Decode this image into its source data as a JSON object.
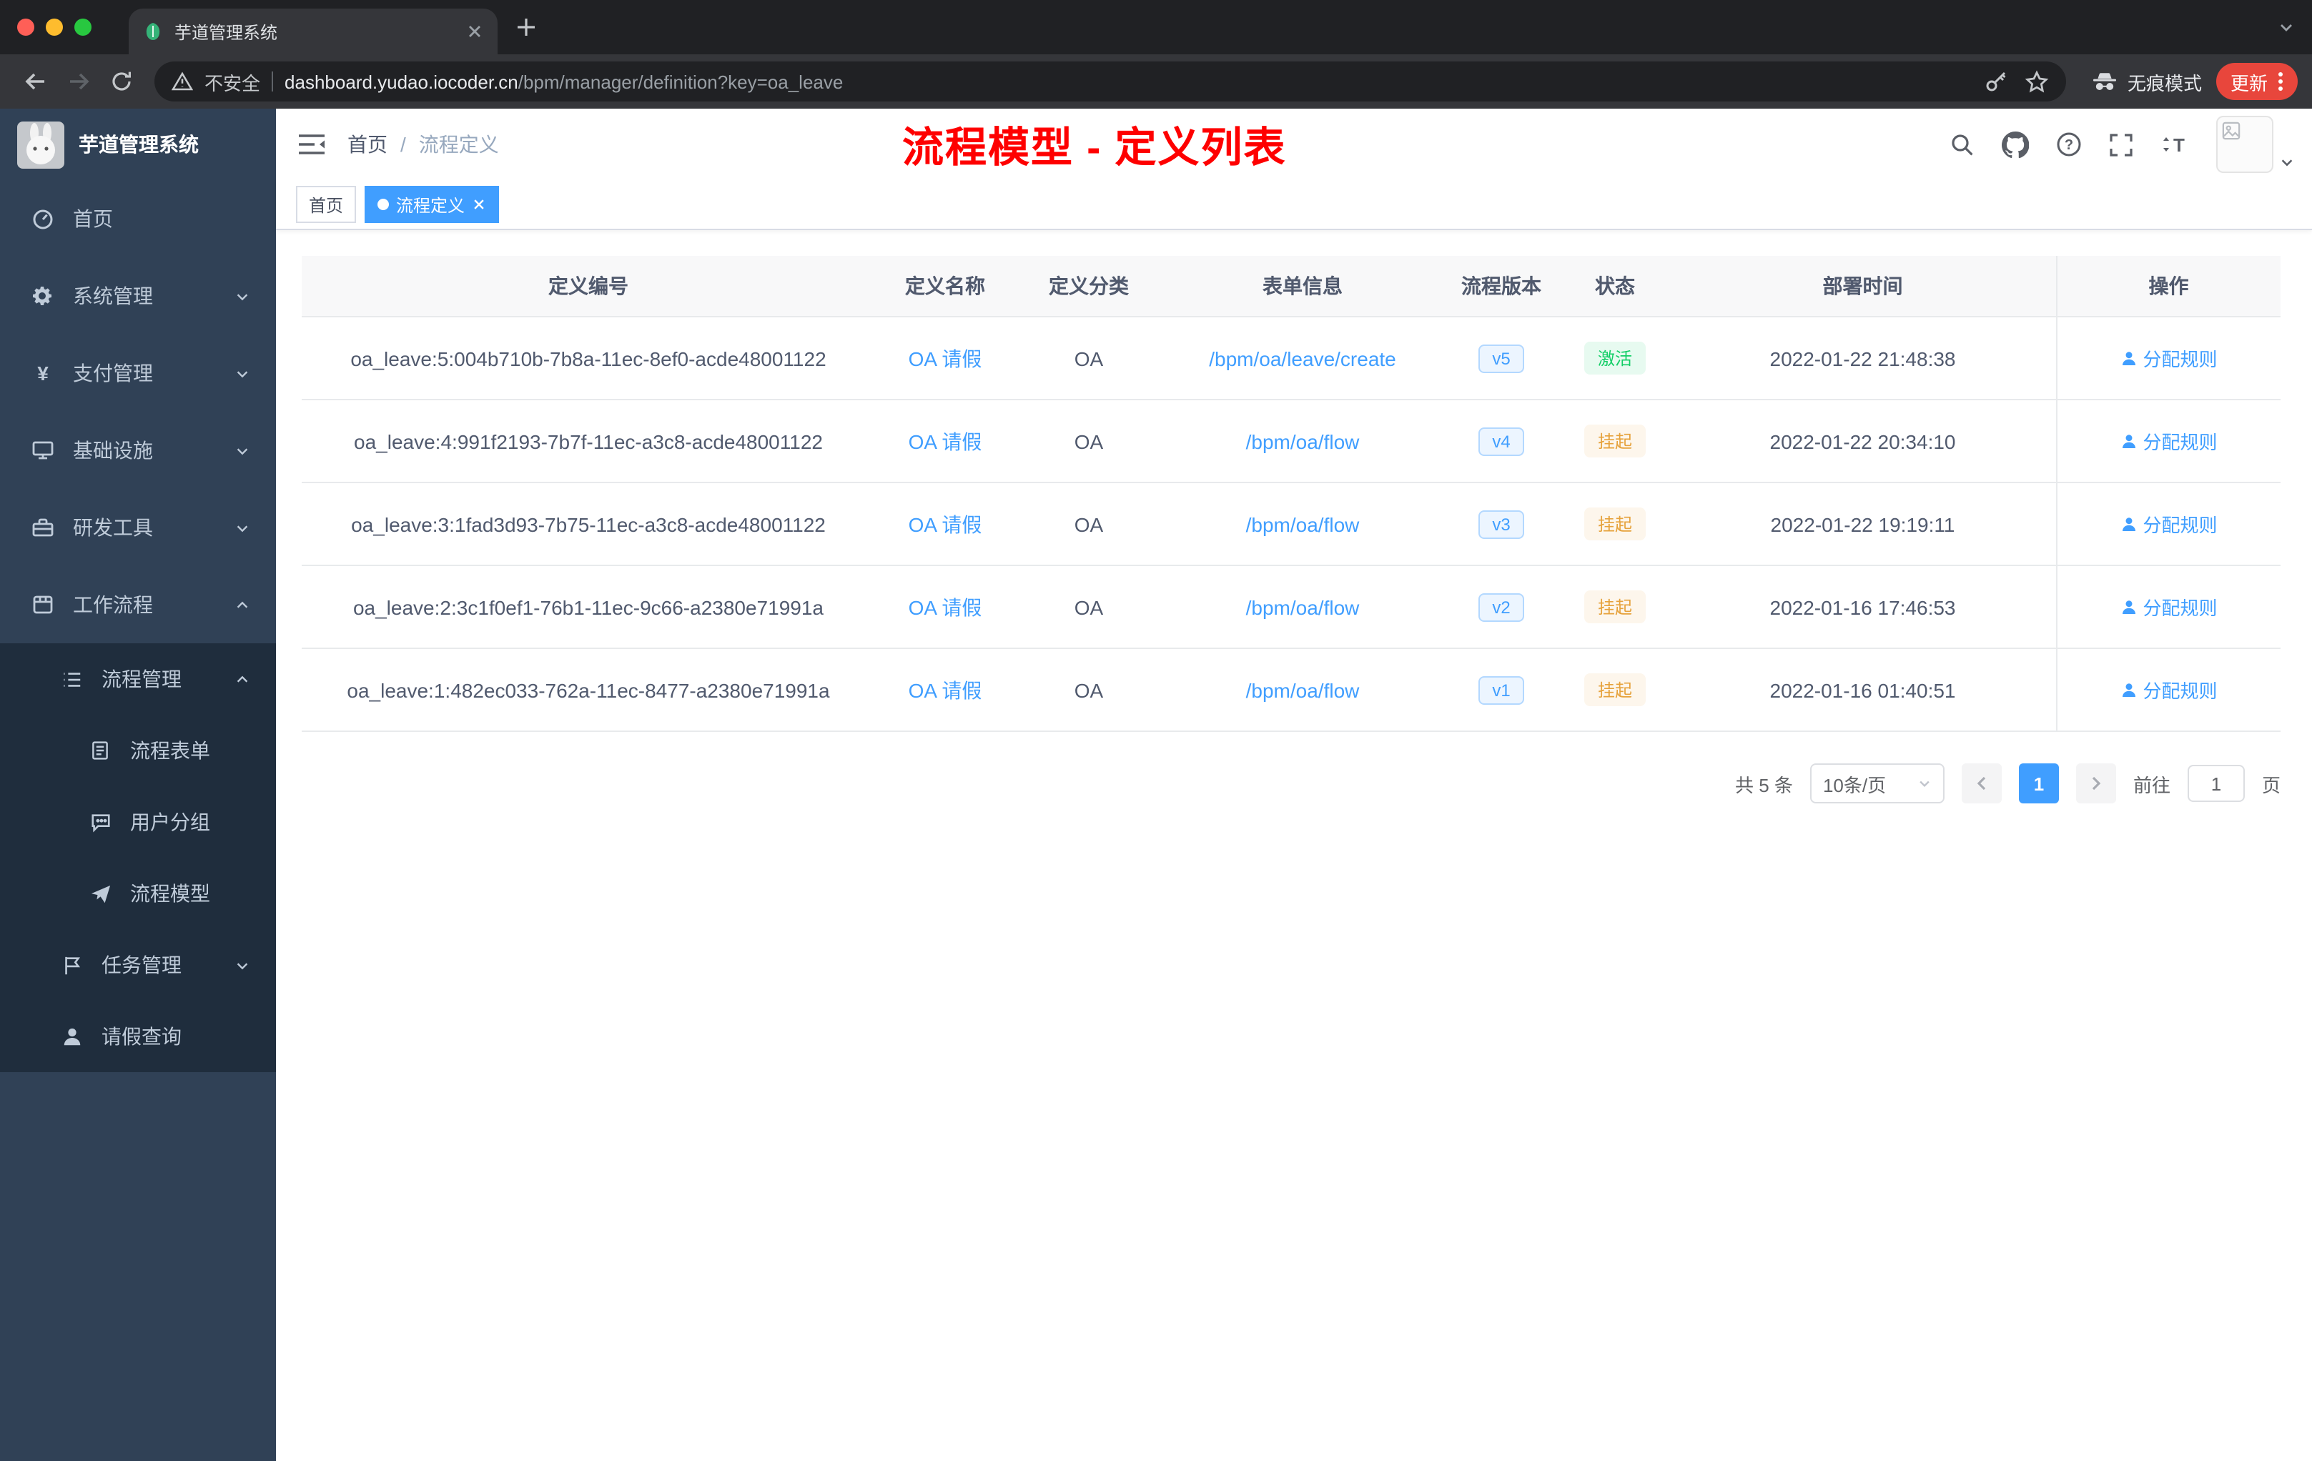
{
  "browser": {
    "tab_title": "芋道管理系统",
    "security_label": "不安全",
    "url_domain": "dashboard.yudao.iocoder.cn",
    "url_path": "/bpm/manager/definition?key=oa_leave",
    "incognito_label": "无痕模式",
    "update_label": "更新"
  },
  "sidebar": {
    "title": "芋道管理系统",
    "items": [
      {
        "label": "首页"
      },
      {
        "label": "系统管理"
      },
      {
        "label": "支付管理"
      },
      {
        "label": "基础设施"
      },
      {
        "label": "研发工具"
      },
      {
        "label": "工作流程"
      },
      {
        "label": "流程管理"
      },
      {
        "label": "流程表单"
      },
      {
        "label": "用户分组"
      },
      {
        "label": "流程模型"
      },
      {
        "label": "任务管理"
      },
      {
        "label": "请假查询"
      }
    ]
  },
  "header": {
    "breadcrumb": {
      "home": "首页",
      "sep": "/",
      "current": "流程定义"
    },
    "annotation": "流程模型 - 定义列表"
  },
  "tags": {
    "home": "首页",
    "active": "流程定义"
  },
  "table": {
    "columns": [
      "定义编号",
      "定义名称",
      "定义分类",
      "表单信息",
      "流程版本",
      "状态",
      "部署时间",
      "操作"
    ],
    "action_label": "分配规则",
    "rows": [
      {
        "id": "oa_leave:5:004b710b-7b8a-11ec-8ef0-acde48001122",
        "name": "OA 请假",
        "category": "OA",
        "form": "/bpm/oa/leave/create",
        "version": "v5",
        "status": "激活",
        "time": "2022-01-22 21:48:38"
      },
      {
        "id": "oa_leave:4:991f2193-7b7f-11ec-a3c8-acde48001122",
        "name": "OA 请假",
        "category": "OA",
        "form": "/bpm/oa/flow",
        "version": "v4",
        "status": "挂起",
        "time": "2022-01-22 20:34:10"
      },
      {
        "id": "oa_leave:3:1fad3d93-7b75-11ec-a3c8-acde48001122",
        "name": "OA 请假",
        "category": "OA",
        "form": "/bpm/oa/flow",
        "version": "v3",
        "status": "挂起",
        "time": "2022-01-22 19:19:11"
      },
      {
        "id": "oa_leave:2:3c1f0ef1-76b1-11ec-9c66-a2380e71991a",
        "name": "OA 请假",
        "category": "OA",
        "form": "/bpm/oa/flow",
        "version": "v2",
        "status": "挂起",
        "time": "2022-01-16 17:46:53"
      },
      {
        "id": "oa_leave:1:482ec033-762a-11ec-8477-a2380e71991a",
        "name": "OA 请假",
        "category": "OA",
        "form": "/bpm/oa/flow",
        "version": "v1",
        "status": "挂起",
        "time": "2022-01-16 01:40:51"
      }
    ]
  },
  "pagination": {
    "total": "共 5 条",
    "page_size": "10条/页",
    "page": "1",
    "goto_label": "前往",
    "goto_value": "1",
    "page_unit": "页"
  },
  "colors": {
    "accent": "#409eff",
    "success": "#13ce66",
    "warning": "#e6a23c",
    "annotation": "#fe0000",
    "sidebar_bg": "#304156",
    "submenu_bg": "#1f2d3d",
    "update_pill": "#e8463c"
  }
}
